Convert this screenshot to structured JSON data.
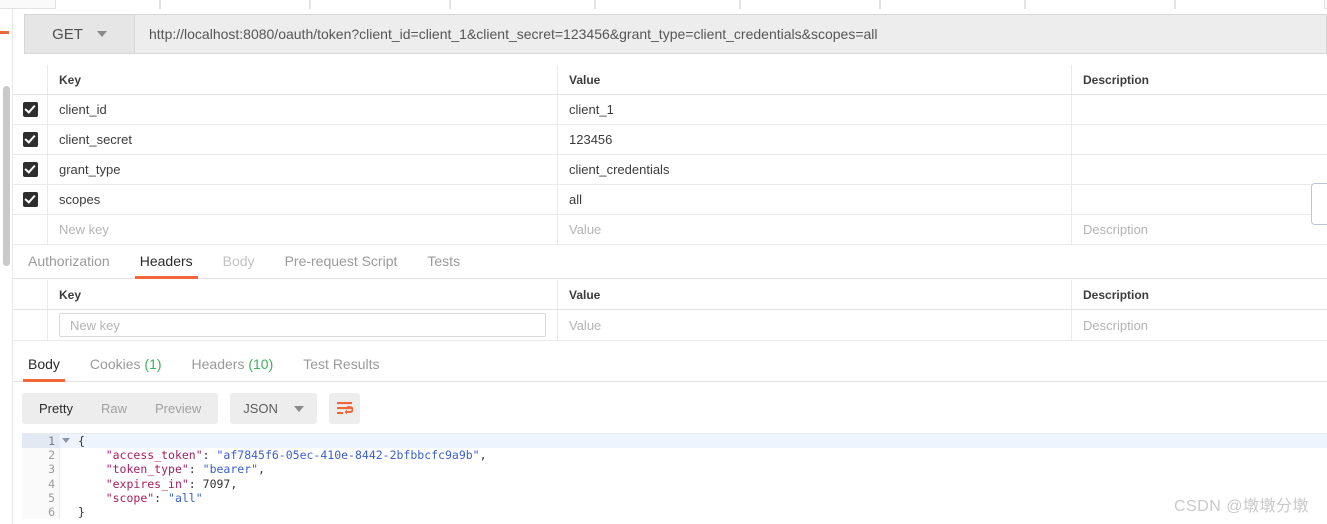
{
  "request": {
    "method": "GET",
    "url": "http://localhost:8080/oauth/token?client_id=client_1&client_secret=123456&grant_type=client_credentials&scopes=all"
  },
  "params_table": {
    "columns": {
      "key": "Key",
      "value": "Value",
      "description": "Description"
    },
    "rows": [
      {
        "checked": true,
        "key": "client_id",
        "value": "client_1",
        "description": ""
      },
      {
        "checked": true,
        "key": "client_secret",
        "value": "123456",
        "description": ""
      },
      {
        "checked": true,
        "key": "grant_type",
        "value": "client_credentials",
        "description": ""
      },
      {
        "checked": true,
        "key": "scopes",
        "value": "all",
        "description": ""
      }
    ],
    "new_row": {
      "key_placeholder": "New key",
      "value_placeholder": "Value",
      "description_placeholder": "Description"
    }
  },
  "request_tabs": [
    {
      "label": "Authorization",
      "active": false,
      "dim": false
    },
    {
      "label": "Headers",
      "active": true,
      "dim": false
    },
    {
      "label": "Body",
      "active": false,
      "dim": true
    },
    {
      "label": "Pre-request Script",
      "active": false,
      "dim": false
    },
    {
      "label": "Tests",
      "active": false,
      "dim": false
    }
  ],
  "headers_table": {
    "columns": {
      "key": "Key",
      "value": "Value",
      "description": "Description"
    },
    "new_row": {
      "key_placeholder": "New key",
      "value_placeholder": "Value",
      "description_placeholder": "Description"
    }
  },
  "response_tabs": [
    {
      "label": "Body",
      "count": "",
      "active": true
    },
    {
      "label": "Cookies",
      "count": "(1)",
      "active": false
    },
    {
      "label": "Headers",
      "count": "(10)",
      "active": false
    },
    {
      "label": "Test Results",
      "count": "",
      "active": false
    }
  ],
  "response_toolbar": {
    "view_modes": [
      {
        "label": "Pretty",
        "active": true
      },
      {
        "label": "Raw",
        "active": false
      },
      {
        "label": "Preview",
        "active": false
      }
    ],
    "format": "JSON",
    "wrap_icon": "word-wrap-icon"
  },
  "response_body": {
    "language": "json",
    "lines": [
      {
        "n": "1",
        "folded": false,
        "highlight": true,
        "text": "{"
      },
      {
        "n": "2",
        "highlight": false,
        "text": "    \"access_token\": \"af7845f6-05ec-410e-8442-2bfbbcfc9a9b\","
      },
      {
        "n": "3",
        "highlight": false,
        "text": "    \"token_type\": \"bearer\","
      },
      {
        "n": "4",
        "highlight": false,
        "text": "    \"expires_in\": 7097,"
      },
      {
        "n": "5",
        "highlight": false,
        "text": "    \"scope\": \"all\""
      },
      {
        "n": "6",
        "highlight": false,
        "text": "}"
      }
    ],
    "parsed": {
      "access_token": "af7845f6-05ec-410e-8442-2bfbbcfc9a9b",
      "token_type": "bearer",
      "expires_in": 7097,
      "scope": "all"
    }
  },
  "watermark": "CSDN @墩墩分墩",
  "colors": {
    "accent": "#f1663a",
    "count_green": "#3fae5f",
    "json_key": "#a71d5d",
    "json_string": "#3a5fcd",
    "checkbox": "#2e2e2e"
  }
}
